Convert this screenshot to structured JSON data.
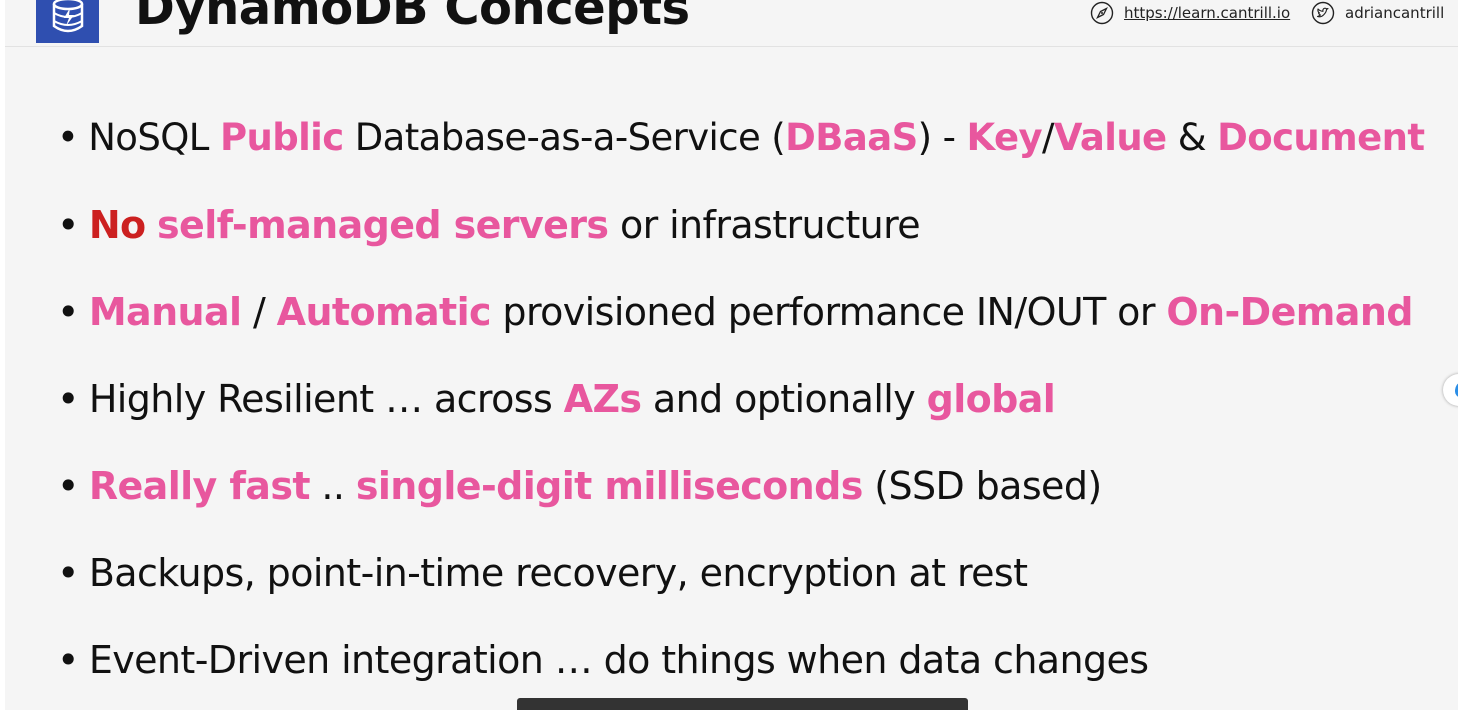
{
  "header": {
    "title": "DynamoDB Concepts",
    "site_link": "https://learn.cantrill.io",
    "twitter_handle": "adriancantrill"
  },
  "bullets": [
    [
      {
        "text": "NoSQL "
      },
      {
        "text": "Public",
        "style": "pink"
      },
      {
        "text": " Database-as-a-Service ("
      },
      {
        "text": "DBaaS",
        "style": "pink"
      },
      {
        "text": ") - "
      },
      {
        "text": "Key",
        "style": "pink"
      },
      {
        "text": "/"
      },
      {
        "text": "Value",
        "style": "pink"
      },
      {
        "text": " & "
      },
      {
        "text": "Document",
        "style": "pink"
      }
    ],
    [
      {
        "text": "No",
        "style": "red"
      },
      {
        "text": " "
      },
      {
        "text": "self-managed servers",
        "style": "pink"
      },
      {
        "text": " or infrastructure"
      }
    ],
    [
      {
        "text": "Manual",
        "style": "pink"
      },
      {
        "text": " / "
      },
      {
        "text": "Automatic",
        "style": "pink"
      },
      {
        "text": " provisioned performance IN/OUT or "
      },
      {
        "text": "On-Demand",
        "style": "pink"
      }
    ],
    [
      {
        "text": "Highly Resilient … across "
      },
      {
        "text": "AZs",
        "style": "pink"
      },
      {
        "text": " and optionally "
      },
      {
        "text": "global",
        "style": "pink"
      }
    ],
    [
      {
        "text": "Really fast",
        "style": "pink"
      },
      {
        "text": " .. "
      },
      {
        "text": "single-digit milliseconds",
        "style": "pink"
      },
      {
        "text": " (SSD based)"
      }
    ],
    [
      {
        "text": "Backups, point-in-time recovery, encryption at rest"
      }
    ],
    [
      {
        "text": "Event-Driven integration … do things when data changes"
      }
    ]
  ],
  "colors": {
    "accent_pink": "#e8579e",
    "accent_red": "#cc2020",
    "logo_blue": "#2f4fb0",
    "slide_background": "#f5f5f5"
  },
  "icons": {
    "site": "compass-icon",
    "twitter": "twitter-bird-icon",
    "logo": "dynamodb-logo-icon",
    "side_widget": "water-drop-icon"
  }
}
